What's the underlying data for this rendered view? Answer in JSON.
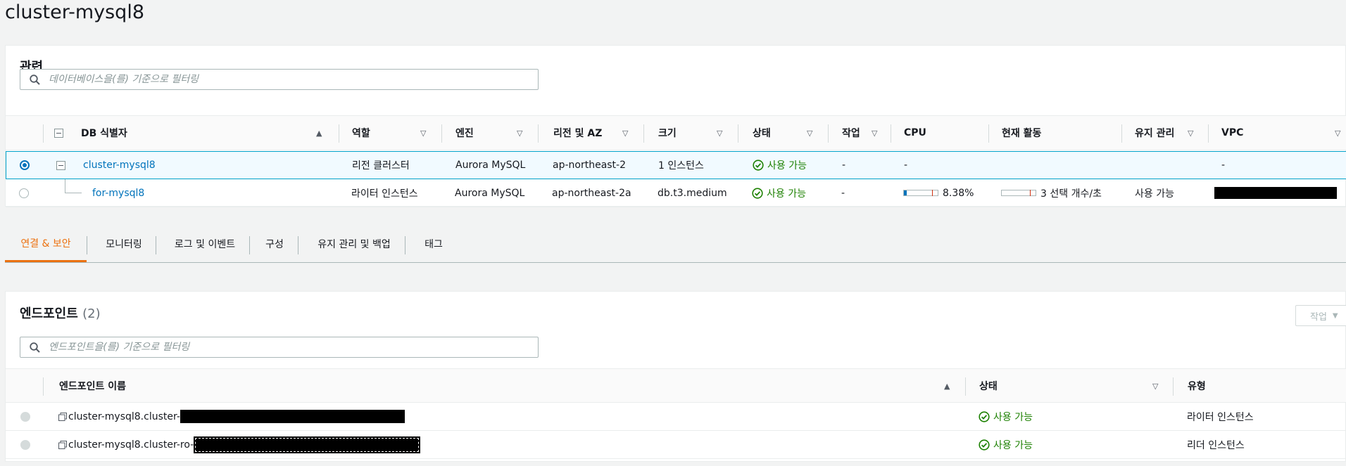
{
  "page": {
    "title": "cluster-mysql8"
  },
  "related": {
    "heading": "관련",
    "search_placeholder": "데이터베이스을(를) 기준으로 필터링",
    "columns": {
      "db_id": "DB 식별자",
      "role": "역할",
      "engine": "엔진",
      "region_az": "리전 및 AZ",
      "size": "크기",
      "status": "상태",
      "actions": "작업",
      "cpu": "CPU",
      "activity": "현재 활동",
      "maintenance": "유지 관리",
      "vpc": "VPC"
    },
    "rows": [
      {
        "db_id": "cluster-mysql8",
        "role": "리전 클러스터",
        "engine": "Aurora MySQL",
        "region_az": "ap-northeast-2",
        "size": "1 인스턴스",
        "status": "사용 가능",
        "actions": "-",
        "cpu": "-",
        "activity": "",
        "maintenance": "",
        "vpc": "-",
        "selected": true
      },
      {
        "db_id": "for-mysql8",
        "role": "라이터 인스턴스",
        "engine": "Aurora MySQL",
        "region_az": "ap-northeast-2a",
        "size": "db.t3.medium",
        "status": "사용 가능",
        "actions": "-",
        "cpu": "8.38%",
        "cpu_fraction": 0.0838,
        "activity": "3 선택 개수/초",
        "maintenance": "사용 가능",
        "vpc_redacted": true,
        "selected": false
      }
    ]
  },
  "tabs": [
    {
      "label": "연결 & 보안",
      "active": true
    },
    {
      "label": "모니터링",
      "active": false
    },
    {
      "label": "로그 및 이벤트",
      "active": false
    },
    {
      "label": "구성",
      "active": false
    },
    {
      "label": "유지 관리 및 백업",
      "active": false
    },
    {
      "label": "태그",
      "active": false
    }
  ],
  "endpoints": {
    "heading": "엔드포인트",
    "count": "(2)",
    "action_button": "작업",
    "search_placeholder": "엔드포인트을(를) 기준으로 필터링",
    "columns": {
      "name": "엔드포인트 이름",
      "status": "상태",
      "type": "유형"
    },
    "rows": [
      {
        "name": "cluster-mysql8.cluster-",
        "status": "사용 가능",
        "type": "라이터 인스턴스"
      },
      {
        "name": "cluster-mysql8.cluster-ro-",
        "status": "사용 가능",
        "type": "리더 인스턴스"
      }
    ]
  },
  "colors": {
    "link": "#0073bb",
    "status_ok": "#1d8102",
    "active_tab": "#ec7211",
    "selected_border": "#00a1c9"
  },
  "icons": [
    "search-icon",
    "collapse-icon",
    "sort-asc-icon",
    "sort-desc-icon",
    "check-circle-icon",
    "copy-icon",
    "caret-down-icon"
  ]
}
